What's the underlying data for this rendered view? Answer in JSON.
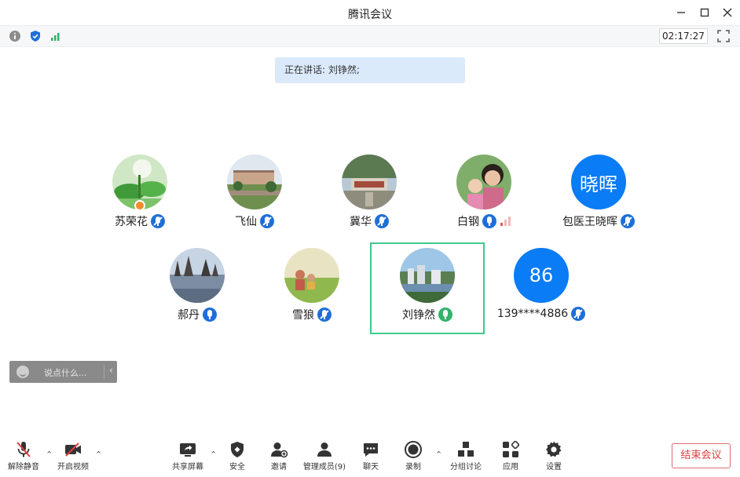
{
  "window": {
    "title": "腾讯会议"
  },
  "toolbar": {
    "timer": "02:17:27"
  },
  "speaking": {
    "prefix": "正在讲话:",
    "name": "刘铮然;"
  },
  "participants": [
    {
      "name": "苏荣花",
      "avatar": "photo-lotus",
      "mic": "muted",
      "host": true
    },
    {
      "name": "飞仙",
      "avatar": "photo-campus",
      "mic": "muted"
    },
    {
      "name": "冀华",
      "avatar": "photo-building",
      "mic": "muted"
    },
    {
      "name": "白钢",
      "avatar": "photo-family",
      "mic": "on",
      "signal": true
    },
    {
      "name": "包医王晓晖",
      "avatar_text": "晓晖",
      "mic": "muted"
    },
    {
      "name": "郝丹",
      "avatar": "photo-lake",
      "mic": "on"
    },
    {
      "name": "雪狼",
      "avatar": "photo-field",
      "mic": "muted"
    },
    {
      "name": "刘铮然",
      "avatar": "photo-city",
      "mic": "speaking",
      "active": true
    },
    {
      "name": "139****4886",
      "avatar_text": "86",
      "mic": "muted"
    }
  ],
  "chat": {
    "placeholder": "说点什么..."
  },
  "bottom": {
    "unmute": "解除静音",
    "video": "开启视频",
    "share": "共享屏幕",
    "security": "安全",
    "invite": "邀请",
    "members": "管理成员(9)",
    "chat": "聊天",
    "record": "录制",
    "breakout": "分组讨论",
    "apps": "应用",
    "settings": "设置",
    "end": "结束会议"
  },
  "colors": {
    "accent": "#0a7cf5",
    "active_border": "#40c98c",
    "end": "#e03e3e"
  }
}
